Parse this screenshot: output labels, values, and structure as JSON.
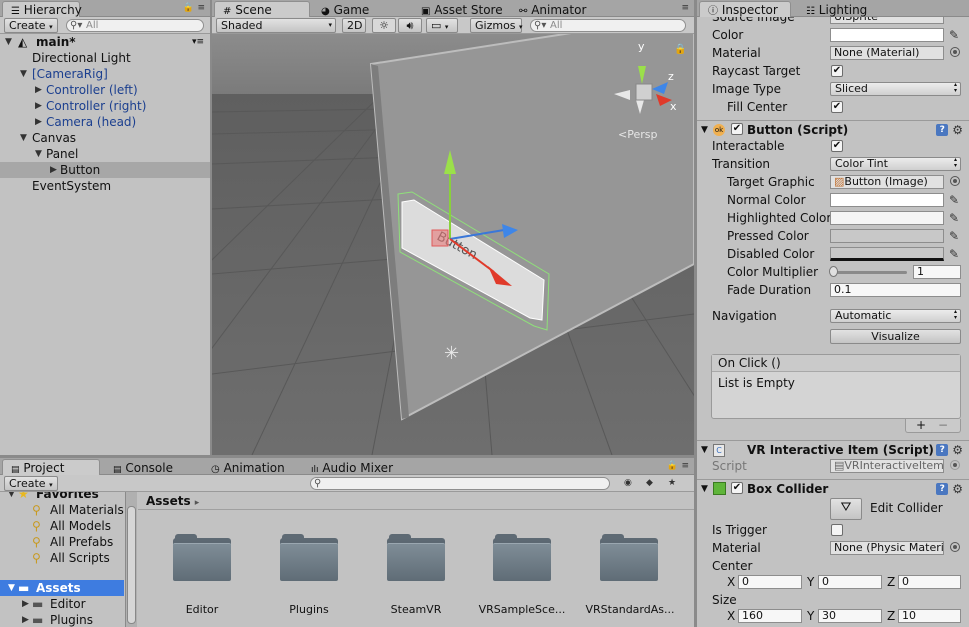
{
  "hierarchy": {
    "tab": "Hierarchy",
    "create": "Create",
    "search_placeholder": "All",
    "scene": "main*",
    "items": [
      {
        "label": "Directional Light",
        "blue": false,
        "arrow": ""
      },
      {
        "label": "[CameraRig]",
        "blue": true,
        "arrow": "▼"
      },
      {
        "label": "Controller (left)",
        "blue": true,
        "arrow": "▶"
      },
      {
        "label": "Controller (right)",
        "blue": true,
        "arrow": "▶"
      },
      {
        "label": "Camera (head)",
        "blue": true,
        "arrow": "▶"
      },
      {
        "label": "Canvas",
        "blue": false,
        "arrow": "▼"
      },
      {
        "label": "Panel",
        "blue": false,
        "arrow": "▼"
      },
      {
        "label": "Button",
        "blue": false,
        "arrow": "▶"
      },
      {
        "label": "EventSystem",
        "blue": false,
        "arrow": ""
      }
    ]
  },
  "scene_view": {
    "tabs": [
      "Scene",
      "Game",
      "Asset Store",
      "Animator"
    ],
    "shading": "Shaded",
    "mode_2d": "2D",
    "gizmos": "Gizmos",
    "search_placeholder": "All",
    "persp_label": "Persp",
    "axis_labels": {
      "y": "y",
      "z": "z",
      "x": "x"
    },
    "button_text": "Button"
  },
  "project": {
    "tabs": [
      "Project",
      "Console",
      "Animation",
      "Audio Mixer"
    ],
    "create": "Create",
    "favorites_label": "Favorites",
    "favorites": [
      "All Materials",
      "All Models",
      "All Prefabs",
      "All Scripts"
    ],
    "assets_label": "Assets",
    "assets_tree": [
      "Editor",
      "Plugins"
    ],
    "breadcrumb": "Assets",
    "folders": [
      "Editor",
      "Plugins",
      "SteamVR",
      "VRSampleSce...",
      "VRStandardAs..."
    ]
  },
  "inspector": {
    "tabs": [
      "Inspector",
      "Lighting"
    ],
    "image": {
      "source_image_label": "Source Image",
      "source_image_value": "UISprite",
      "color_label": "Color",
      "material_label": "Material",
      "material_value": "None (Material)",
      "raycast_label": "Raycast Target",
      "image_type_label": "Image Type",
      "image_type_value": "Sliced",
      "fill_center_label": "Fill Center"
    },
    "button": {
      "title": "Button (Script)",
      "interactable_label": "Interactable",
      "transition_label": "Transition",
      "transition_value": "Color Tint",
      "target_graphic_label": "Target Graphic",
      "target_graphic_value": "Button (Image)",
      "normal_color_label": "Normal Color",
      "highlighted_color_label": "Highlighted Color",
      "pressed_color_label": "Pressed Color",
      "disabled_color_label": "Disabled Color",
      "multiplier_label": "Color Multiplier",
      "multiplier_value": "1",
      "multiplier_fraction": 0.2,
      "fade_label": "Fade Duration",
      "fade_value": "0.1",
      "navigation_label": "Navigation",
      "navigation_value": "Automatic",
      "visualize": "Visualize",
      "onclick_label": "On Click ()",
      "onclick_empty": "List is Empty",
      "plus": "+",
      "minus": "−"
    },
    "vr_item": {
      "title": "VR Interactive Item (Script)",
      "script_label": "Script",
      "script_value": "VRInteractiveItem"
    },
    "box_collider": {
      "title": "Box Collider",
      "edit_collider": "Edit Collider",
      "is_trigger_label": "Is Trigger",
      "material_label": "Material",
      "material_value": "None (Physic Material)",
      "center_label": "Center",
      "center": {
        "x": "0",
        "y": "0",
        "z": "0"
      },
      "size_label": "Size",
      "size": {
        "x": "160",
        "y": "30",
        "z": "10"
      }
    }
  },
  "colors": {
    "panel_bg": "#c2c2c2",
    "scene_bg": "#6e6e6e",
    "selection": "#3e7ce0",
    "link_blue": "#1b3f8f"
  }
}
